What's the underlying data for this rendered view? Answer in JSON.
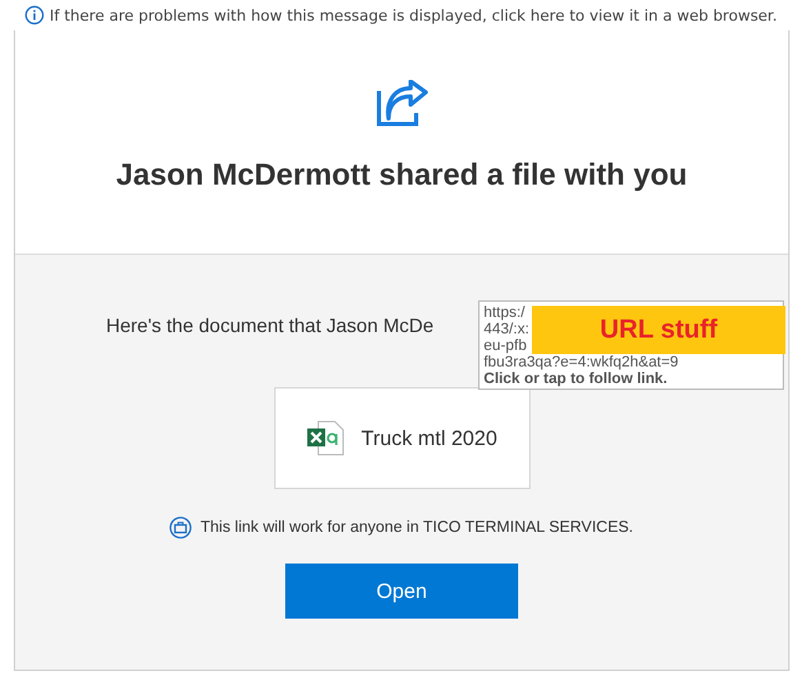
{
  "info_bar": {
    "text": "If there are problems with how this message is displayed, click here to view it in a web browser."
  },
  "header": {
    "title": "Jason McDermott shared a file with you"
  },
  "body": {
    "message": "Here's the document that Jason McDe",
    "file": {
      "name": "Truck mtl 2020"
    },
    "notice": "This link will work for anyone in TICO TERMINAL SERVICES.",
    "button": "Open"
  },
  "tooltip": {
    "lines": [
      "https:/",
      "443/:x:",
      "eu-pfb",
      "fbu3ra3qa?e=4:wkfq2h&at=9"
    ],
    "hint": "Click or tap to follow link.",
    "redaction": "URL stuff"
  }
}
